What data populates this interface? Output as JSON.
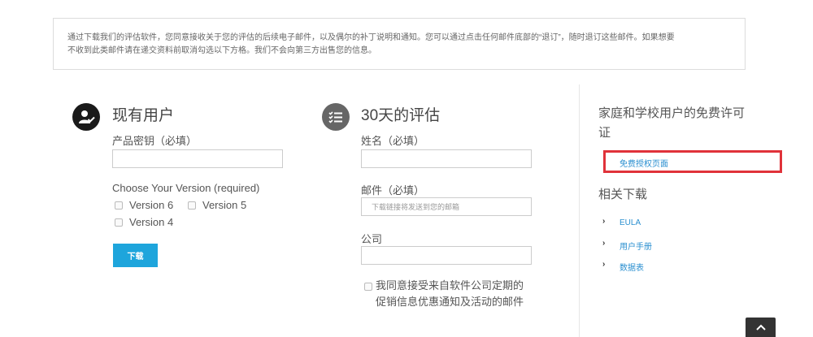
{
  "notice": {
    "line1": "通过下载我们的评估软件，您同意接收关于您的评估的后续电子邮件，以及偶尔的补丁说明和通知。您可以通过点击任何邮件底部的“退订”，随时退订这些邮件。如果想要",
    "line2": "不收到此类邮件请在递交资料前取消勾选以下方格。我们不会向第三方出售您的信息。"
  },
  "existing": {
    "title": "现有用户",
    "product_key_label": "产品密钥（必填）",
    "version_label": "Choose Your Version (required)",
    "versions": [
      "Version 6",
      "Version 5",
      "Version 4"
    ],
    "download_button": "下载"
  },
  "trial": {
    "title": "30天的评估",
    "name_label": "姓名（必填）",
    "email_label": "邮件（必填）",
    "email_placeholder": "下载链接将发送到您的邮箱",
    "company_label": "公司",
    "consent_text": "我同意接受来自软件公司定期的促销信息优惠通知及活动的邮件"
  },
  "sidebar": {
    "free_license_title": "家庭和学校用户的免费许可证",
    "free_license_link": "免费授权页面",
    "downloads_title": "相关下载",
    "links": [
      "EULA",
      "用户手册",
      "数据表"
    ]
  },
  "colors": {
    "accent": "#1ea5dc",
    "highlight": "#e0323a",
    "link": "#2a8fd0",
    "icon_dark": "#1a1a1a",
    "icon_gray": "#666666"
  },
  "icons": [
    "user-check-icon",
    "checklist-icon",
    "chevron-right-icon",
    "chevron-up-icon"
  ]
}
